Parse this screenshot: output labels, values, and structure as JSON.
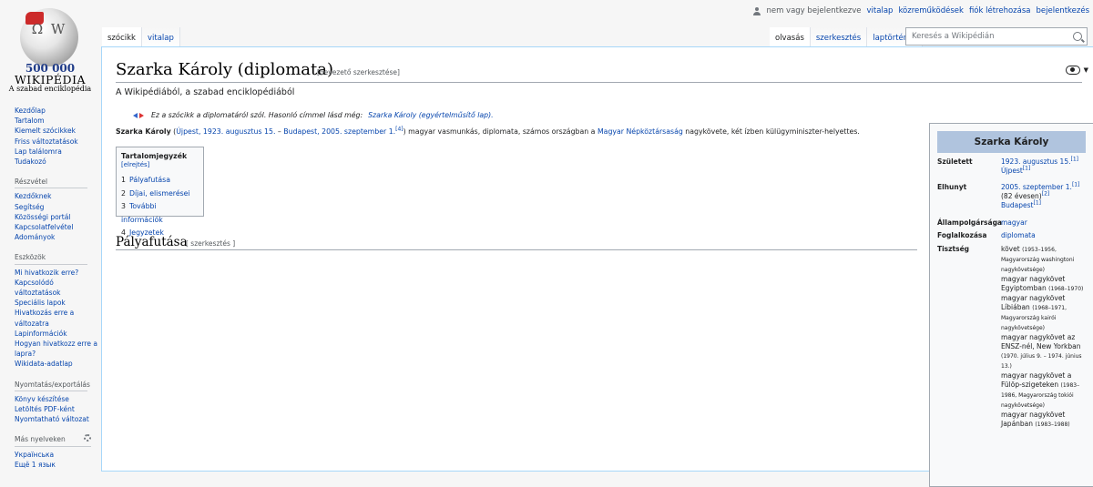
{
  "logo": {
    "count": "500 000",
    "wordmark": "WIKIPÉDIA",
    "tagline": "A szabad enciklopédia",
    "globe_letters": "Ω W"
  },
  "personal": {
    "not_logged_in": "nem vagy bejelentkezve",
    "talk": "vitalap",
    "contributions": "közreműködések",
    "create_account": "fiók létrehozása",
    "login": "bejelentkezés"
  },
  "tabs": {
    "article": "szócikk",
    "talk": "vitalap",
    "read": "olvasás",
    "edit": "szerkesztés",
    "history": "laptörténet"
  },
  "search": {
    "placeholder": "Keresés a Wikipédián"
  },
  "sidebar": {
    "main": [
      "Kezdőlap",
      "Tartalom",
      "Kiemelt szócikkek",
      "Friss változtatások",
      "Lap találomra",
      "Tudakozó"
    ],
    "participation_head": "Részvétel",
    "participation": [
      "Kezdőknek",
      "Segítség",
      "Közösségi portál",
      "Kapcsolatfelvétel",
      "Adományok"
    ],
    "tools_head": "Eszközök",
    "tools": [
      "Mi hivatkozik erre?",
      "Kapcsolódó változtatások",
      "Speciális lapok",
      "Hivatkozás erre a változatra",
      "Lapinformációk",
      "Hogyan hivatkozz erre a lapra?",
      "Wikidata-adatlap"
    ],
    "print_head": "Nyomtatás/exportálás",
    "print": [
      "Könyv készítése",
      "Letöltés PDF-ként",
      "Nyomtatható változat"
    ],
    "lang_head": "Más nyelveken",
    "langs": [
      "Українська",
      "Ещё 1 язык"
    ]
  },
  "article": {
    "title": "Szarka Károly (diplomata)",
    "title_edit": "[bevezető szerkesztése]",
    "tagline": "A Wikipédiából, a szabad enciklopédiából",
    "hatnote_text": "Ez a szócikk a diplomatáról szól. Hasonló címmel lásd még:",
    "hatnote_link": "Szarka Károly (egyértelműsítő lap).",
    "lead": {
      "name": "Szarka Károly",
      "p1": "(",
      "born_link": "Újpest, 1923. augusztus 15.",
      "dash": " – ",
      "died_link": "Budapest, 2005. szeptember 1.",
      "ref": "[4]",
      "rest1": ") magyar vasmunkás, diplomata, számos országban a ",
      "country_link": "Magyar Népköztársaság",
      "rest2": " nagykövete, két ízben külügyminiszter-helyettes."
    },
    "toc": {
      "title": "Tartalomjegyzék",
      "hide": "[elrejtés]",
      "items": [
        {
          "num": "1",
          "label": "Pályafutása"
        },
        {
          "num": "2",
          "label": "Díjai, elismerései"
        },
        {
          "num": "3",
          "label": "További információk"
        },
        {
          "num": "4",
          "label": "Jegyzetek"
        }
      ]
    },
    "section1": {
      "heading": "Pályafutása",
      "edit": "[ szerkesztés ]"
    }
  },
  "infobox": {
    "title": "Szarka Károly",
    "born_label": "Született",
    "born_date": "1923. augusztus 15.",
    "born_place": "Újpest",
    "died_label": "Elhunyt",
    "died_date": "2005. szeptember 1.",
    "died_age": "(82 évesen)",
    "died_place": "Budapest",
    "citizenship_label": "Állampolgársága",
    "citizenship": "magyar",
    "occupation_label": "Foglalkozása",
    "occupation": "diplomata",
    "offices_label": "Tisztség",
    "offices": [
      {
        "main": "követ",
        "note": "(1953–1956, Magyarország washingtoni nagykövetsége)"
      },
      {
        "main": "magyar nagykövet Egyiptomban",
        "note": "(1968–1970)"
      },
      {
        "main": "magyar nagykövet Líbiában",
        "note": "(1968–1971, Magyarország kairói nagykövetsége)"
      },
      {
        "main": "magyar nagykövet az ENSZ-nél, New Yorkban",
        "note": "(1970. július 9. – 1974. június 13.)"
      },
      {
        "main": "magyar nagykövet a Fülöp-szigeteken",
        "note": "(1983–1986, Magyarország tokiói nagykövetsége)"
      },
      {
        "main": "magyar nagykövet Japánban",
        "note": "(1983–1988)"
      }
    ]
  }
}
